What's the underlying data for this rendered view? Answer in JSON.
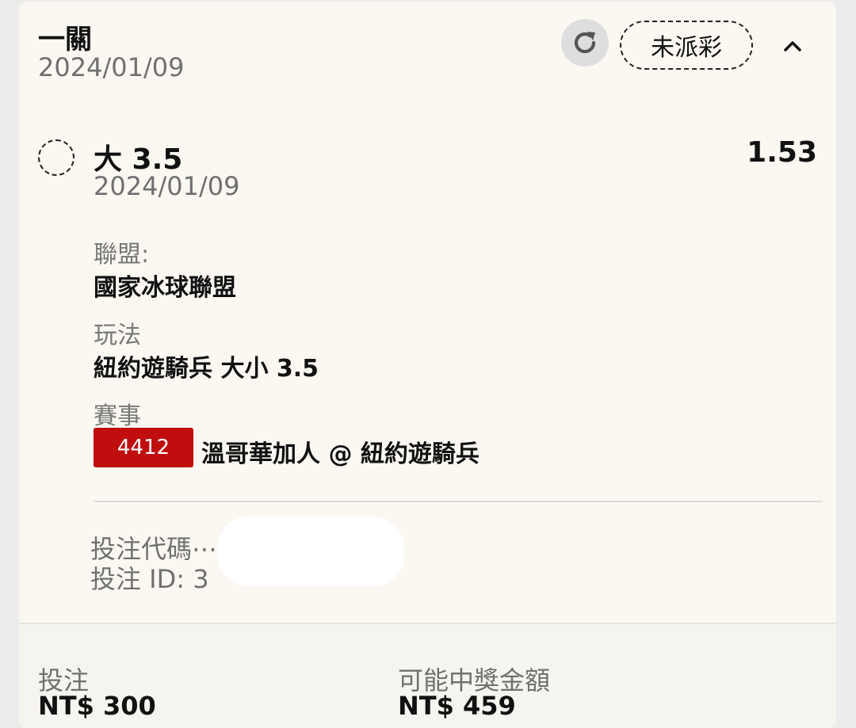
{
  "header": {
    "title": "一關",
    "date": "2024/01/09",
    "status": "未派彩",
    "icons": {
      "refresh": "refresh-icon",
      "collapse": "chevron-up-icon"
    }
  },
  "selection": {
    "name": "大 3.5",
    "date": "2024/01/09",
    "odds": "1.53",
    "league_label": "聯盟:",
    "league_value": "國家冰球聯盟",
    "market_label": "玩法",
    "market_value": "紐約遊騎兵 大小 3.5",
    "event_label": "賽事",
    "event_id": "4412",
    "event_name": "溫哥華加人 @ 紐約遊騎兵"
  },
  "reference": {
    "code_label": "投注代碼⋯ ·",
    "id_label": "投注 ID: 3"
  },
  "footer": {
    "stake_label": "投注",
    "stake_value": "NT$ 300",
    "payout_label": "可能中獎金額",
    "payout_value": "NT$ 459"
  },
  "colors": {
    "badge": "#c00d0d",
    "card_bg": "#faf8f1",
    "muted_text": "#707070"
  }
}
